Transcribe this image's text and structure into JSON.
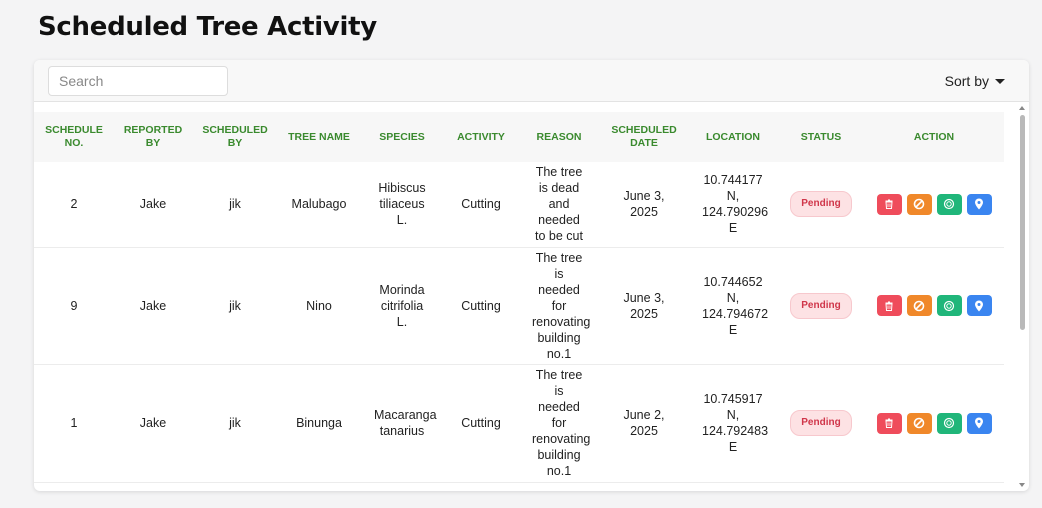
{
  "page": {
    "title": "Scheduled Tree Activity"
  },
  "toolbar": {
    "search_placeholder": "Search",
    "sort_label": "Sort by"
  },
  "table": {
    "headers": {
      "schedule_no": "SCHEDULE NO.",
      "reported_by": "REPORTED BY",
      "scheduled_by": "SCHEDULED BY",
      "tree_name": "TREE NAME",
      "species": "SPECIES",
      "activity": "ACTIVITY",
      "reason": "REASON",
      "scheduled_date": "SCHEDULED DATE",
      "location": "LOCATION",
      "status": "STATUS",
      "action": "ACTION"
    },
    "rows": [
      {
        "schedule_no": "2",
        "reported_by": "Jake",
        "scheduled_by": "jik",
        "tree_name": "Malubago",
        "species": "Hibiscus tiliaceus L.",
        "activity": "Cutting",
        "reason": "The tree is dead and needed to be cut",
        "scheduled_date": "June 3, 2025",
        "location": "10.744177 N, 124.790296 E",
        "status": "Pending"
      },
      {
        "schedule_no": "9",
        "reported_by": "Jake",
        "scheduled_by": "jik",
        "tree_name": "Nino",
        "species": "Morinda citrifolia L.",
        "activity": "Cutting",
        "reason": "The tree is needed for renovating building no.1",
        "scheduled_date": "June 3, 2025",
        "location": "10.744652 N, 124.794672 E",
        "status": "Pending"
      },
      {
        "schedule_no": "1",
        "reported_by": "Jake",
        "scheduled_by": "jik",
        "tree_name": "Binunga",
        "species": "Macaranga tanarius",
        "activity": "Cutting",
        "reason": "The tree is needed for renovating building no.1",
        "scheduled_date": "June 2, 2025",
        "location": "10.745917 N, 124.792483 E",
        "status": "Pending"
      }
    ],
    "action_icons": [
      "trash-icon",
      "cancel-icon",
      "complete-icon",
      "location-pin-icon"
    ]
  },
  "colors": {
    "header_text": "#3a8a2e",
    "pending_badge_bg": "#fde2e4",
    "pending_badge_text": "#d0364a",
    "delete_button": "#ef4c5b",
    "cancel_button": "#f0882a",
    "complete_button": "#20b67a",
    "location_button": "#3a85f0"
  }
}
